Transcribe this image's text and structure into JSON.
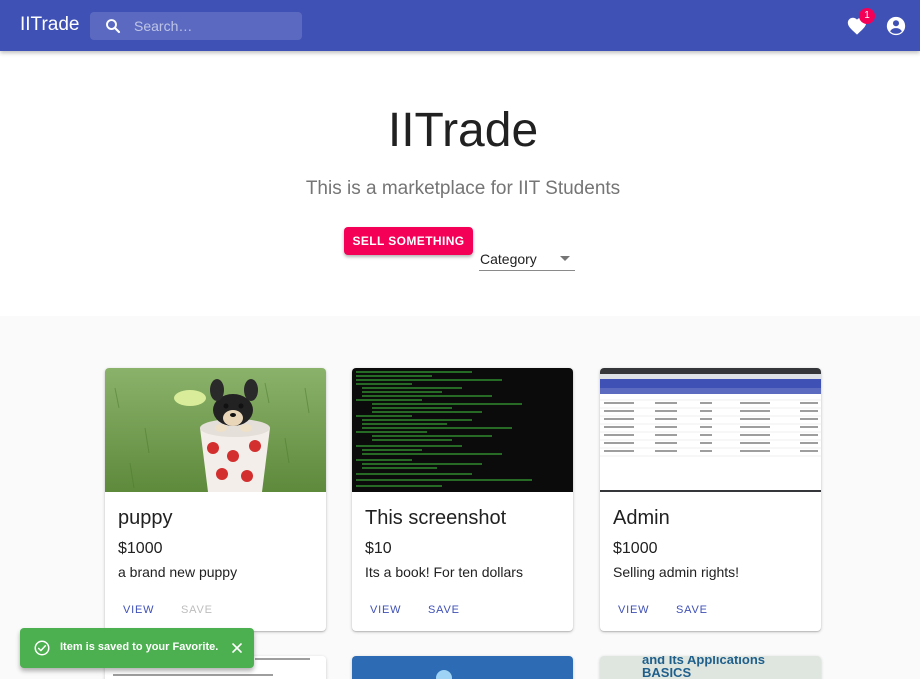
{
  "appbar": {
    "brand": "IITrade",
    "search_placeholder": "Search…",
    "favorites_count": "1"
  },
  "hero": {
    "title": "IITrade",
    "subtitle": "This is a marketplace for IIT Students",
    "sell_label": "SELL SOMETHING",
    "category_label": "Category"
  },
  "cards": [
    {
      "title": "puppy",
      "price": "$1000",
      "description": "a brand new puppy",
      "view_label": "VIEW",
      "save_label": "SAVE",
      "save_enabled": false
    },
    {
      "title": "This screenshot",
      "price": "$10",
      "description": "Its a book! For ten dollars",
      "view_label": "VIEW",
      "save_label": "SAVE",
      "save_enabled": true
    },
    {
      "title": "Admin",
      "price": "$1000",
      "description": "Selling admin rights!",
      "view_label": "VIEW",
      "save_label": "SAVE",
      "save_enabled": true
    }
  ],
  "partial_cards": {
    "third_text_1": "and Its Applications",
    "third_text_2": "BASICS"
  },
  "snackbar": {
    "message": "Item is saved to your Favorite."
  },
  "colors": {
    "primary": "#3f51b5",
    "secondary": "#f50057",
    "success": "#4caf50"
  }
}
